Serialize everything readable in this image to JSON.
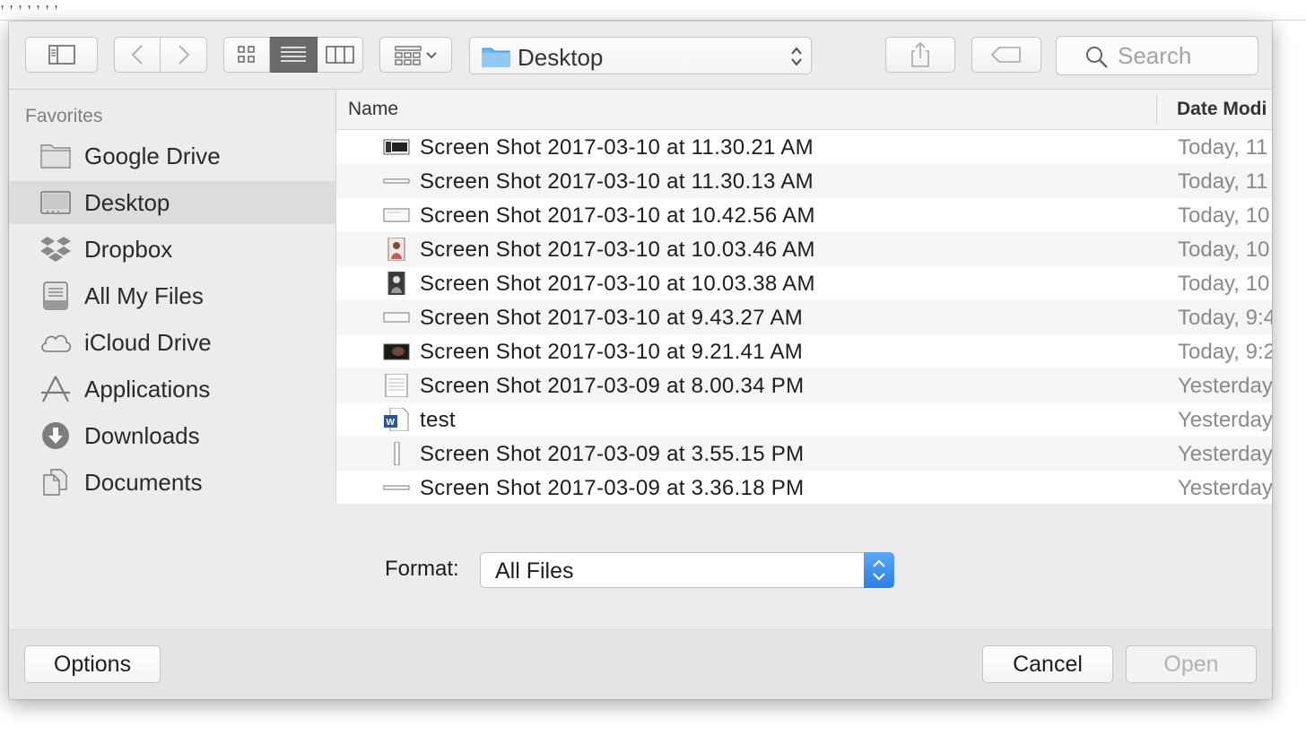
{
  "background": {
    "snippet": ", ,  ,  , , , ,"
  },
  "toolbar": {
    "path_label": "Desktop",
    "search_placeholder": "Search"
  },
  "sidebar": {
    "heading": "Favorites",
    "items": [
      {
        "label": "Google Drive",
        "icon": "folder-icon",
        "selected": false
      },
      {
        "label": "Desktop",
        "icon": "desktop-icon",
        "selected": true
      },
      {
        "label": "Dropbox",
        "icon": "dropbox-icon",
        "selected": false
      },
      {
        "label": "All My Files",
        "icon": "all-files-icon",
        "selected": false
      },
      {
        "label": "iCloud Drive",
        "icon": "cloud-icon",
        "selected": false
      },
      {
        "label": "Applications",
        "icon": "applications-icon",
        "selected": false
      },
      {
        "label": "Downloads",
        "icon": "downloads-icon",
        "selected": false
      },
      {
        "label": "Documents",
        "icon": "documents-icon",
        "selected": false
      }
    ]
  },
  "filelist": {
    "columns": {
      "name": "Name",
      "date": "Date Modi"
    },
    "rows": [
      {
        "name": "Screen Shot 2017-03-10 at 11.30.21 AM",
        "date": "Today, 11",
        "thumb": "dark-screenshot"
      },
      {
        "name": "Screen Shot 2017-03-10 at 11.30.13 AM",
        "date": "Today, 11",
        "thumb": "thin-screenshot"
      },
      {
        "name": "Screen Shot 2017-03-10 at 10.42.56 AM",
        "date": "Today, 10",
        "thumb": "light-screenshot"
      },
      {
        "name": "Screen Shot 2017-03-10 at 10.03.46 AM",
        "date": "Today, 10",
        "thumb": "portrait-photo"
      },
      {
        "name": "Screen Shot 2017-03-10 at 10.03.38 AM",
        "date": "Today, 10",
        "thumb": "portrait-dark"
      },
      {
        "name": "Screen Shot 2017-03-10 at 9.43.27 AM",
        "date": "Today, 9:4",
        "thumb": "light-screenshot"
      },
      {
        "name": "Screen Shot 2017-03-10 at 9.21.41 AM",
        "date": "Today, 9:2",
        "thumb": "dark-photo"
      },
      {
        "name": "Screen Shot 2017-03-09 at 8.00.34 PM",
        "date": "Yesterday",
        "thumb": "document-screenshot"
      },
      {
        "name": "test",
        "date": "Yesterday",
        "thumb": "word-document"
      },
      {
        "name": "Screen Shot 2017-03-09 at 3.55.15 PM",
        "date": "Yesterday",
        "thumb": "tall-screenshot"
      },
      {
        "name": "Screen Shot 2017-03-09 at 3.36.18 PM",
        "date": "Yesterday",
        "thumb": "thin-screenshot"
      }
    ]
  },
  "format": {
    "label": "Format:",
    "value": "All Files"
  },
  "buttons": {
    "options": "Options",
    "cancel": "Cancel",
    "open": "Open"
  },
  "colors": {
    "accent": "#2a7fe6",
    "folder": "#6ab6ef",
    "selected_row": "#dcdcdc"
  }
}
